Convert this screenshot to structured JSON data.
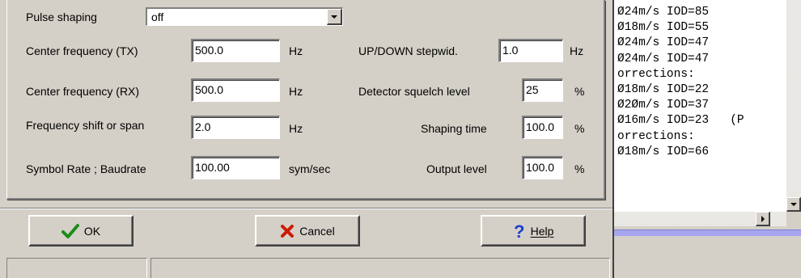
{
  "pulse_shaping": {
    "label": "Pulse shaping",
    "value": "off"
  },
  "left_fields": [
    {
      "label": "Center frequency (TX)",
      "value": "500.0",
      "unit": "Hz"
    },
    {
      "label": "Center frequency (RX)",
      "value": "500.0",
      "unit": "Hz"
    },
    {
      "label": "Frequency shift or span",
      "value": "2.0",
      "unit": "Hz"
    },
    {
      "label": "Symbol Rate ; Baudrate",
      "value": "100.00",
      "unit": "sym/sec"
    }
  ],
  "right_fields": [
    {
      "label": "UP/DOWN stepwid.",
      "value": "1.0",
      "unit": "Hz"
    },
    {
      "label": "Detector squelch level",
      "value": "25",
      "unit": "%"
    },
    {
      "label": "Shaping time",
      "value": "100.0",
      "unit": "%"
    },
    {
      "label": "Output level",
      "value": "100.0",
      "unit": "%"
    }
  ],
  "buttons": {
    "ok": "OK",
    "cancel": "Cancel",
    "help": "Help"
  },
  "log_lines": [
    "Ø24m/s IOD=85",
    "Ø18m/s IOD=55",
    "Ø24m/s IOD=47",
    "Ø24m/s IOD=47",
    "orrections:",
    "Ø18m/s IOD=22",
    "Ø2Øm/s IOD=37",
    "Ø16m/s IOD=23   (P",
    "orrections:",
    "Ø18m/s IOD=66"
  ],
  "colors": {
    "ok_check": "#1a8c1a",
    "cancel_x": "#cc1a00",
    "help_q": "#1c3fd0",
    "log_bar": "#a6a6f0"
  }
}
